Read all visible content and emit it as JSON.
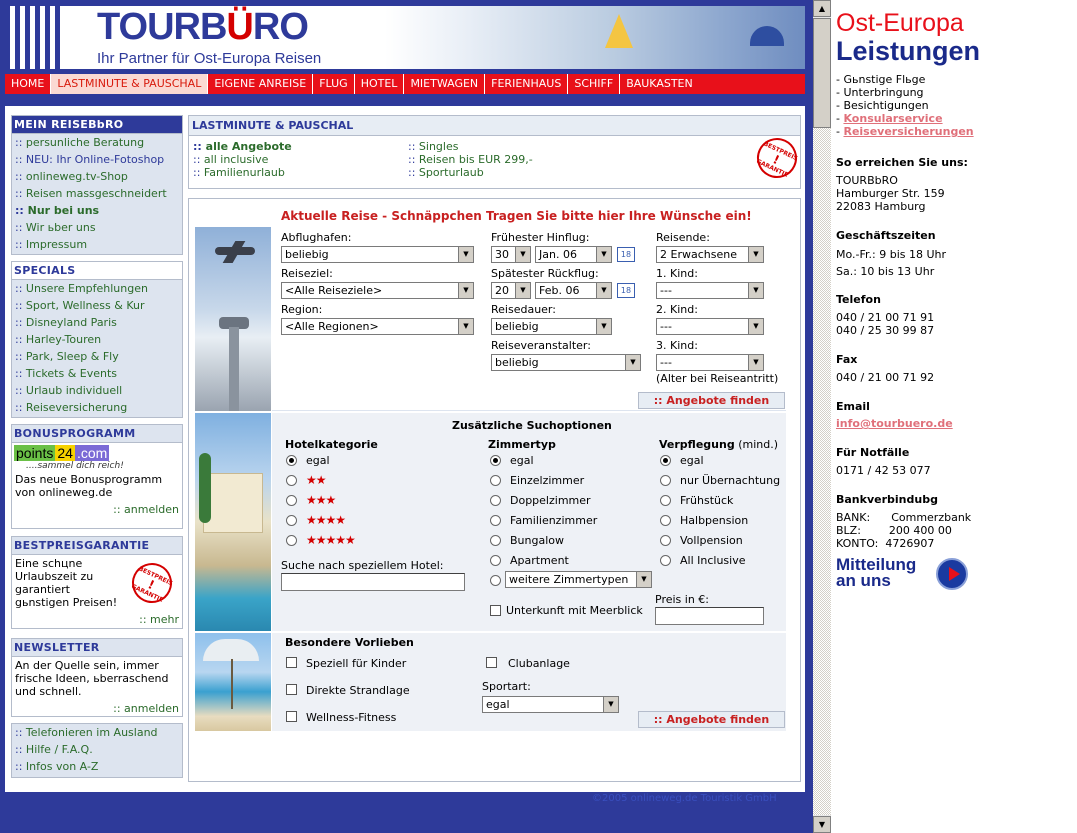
{
  "header": {
    "logo_main": "TOURB",
    "logo_u": "Ü",
    "logo_end": "RO",
    "tagline": "Ihr Partner für Ost-Europa Reisen"
  },
  "nav": [
    "HOME",
    "LASTMINUTE & PAUSCHAL",
    "EIGENE ANREISE",
    "FLUG",
    "HOTEL",
    "MIETWAGEN",
    "FERIENHAUS",
    "SCHIFF",
    "BAUKASTEN"
  ],
  "sidebar": {
    "mein": {
      "title": "MEIN REISEBbRO",
      "items": [
        "persunliche Beratung",
        "NEU: Ihr Online-Fotoshop",
        "onlineweg.tv-Shop",
        "Reisen massgeschneidert",
        "Nur bei uns",
        "Wir ьber uns",
        "Impressum"
      ]
    },
    "specials": {
      "title": "SPECIALS",
      "items": [
        "Unsere Empfehlungen",
        "Sport, Wellness & Kur",
        "Disneyland Paris",
        "Harley-Touren",
        "Park, Sleep & Fly",
        "Tickets & Events",
        "Urlaub individuell",
        "Reiseversicherung"
      ]
    },
    "bonus": {
      "title": "BONUSPROGRAMM",
      "logo_a": "points",
      "logo_b": "24",
      "logo_c": ".com",
      "slogan": "....sammel dich reich!",
      "text": "Das neue Bonusprogramm von onlineweg.de",
      "link": ":: anmelden"
    },
    "bestpreis": {
      "title": "BESTPREISGARANTIE",
      "text": "Eine schцne Urlaubszeit zu garantiert gьnstigen Preisen!",
      "link": ":: mehr",
      "badge_top": "BESTPREIS",
      "badge_bottom": "GARANTIE"
    },
    "newsletter": {
      "title": "NEWSLETTER",
      "text": "An der Quelle sein, immer frische Ideen, ьberraschend und schnell.",
      "link": ":: anmelden"
    },
    "extra": [
      "Telefonieren im Ausland",
      "Hilfe / F.A.Q.",
      "Infos von A-Z"
    ]
  },
  "lastminute": {
    "title": "LASTMINUTE & PAUSCHAL",
    "col1": [
      "alle Angebote",
      "all inclusive",
      "Familienurlaub"
    ],
    "col2": [
      "Singles",
      "Reisen bis EUR 299,-",
      "Sporturlaub"
    ],
    "badge_top": "BESTPREIS",
    "badge_bottom": "GARANTIE"
  },
  "form": {
    "title": "Aktuelle Reise - Schnäppchen Tragen Sie bitte hier Ihre Wünsche ein!",
    "abflughafen_label": "Abflughafen:",
    "abflughafen_value": "beliebig",
    "reiseziel_label": "Reiseziel:",
    "reiseziel_value": "<Alle Reiseziele>",
    "region_label": "Region:",
    "region_value": "<Alle Regionen>",
    "hinflug_label": "Frühester Hinflug:",
    "hinflug_day": "30",
    "hinflug_month": "Jan. 06",
    "rueckflug_label": "Spätester Rückflug:",
    "rueckflug_day": "20",
    "rueckflug_month": "Feb. 06",
    "cal_label": "18",
    "dauer_label": "Reisedauer:",
    "dauer_value": "beliebig",
    "veranstalter_label": "Reiseveranstalter:",
    "veranstalter_value": "beliebig",
    "reisende_label": "Reisende:",
    "reisende_value": "2 Erwachsene",
    "kind1_label": "1. Kind:",
    "kind2_label": "2. Kind:",
    "kind3_label": "3. Kind:",
    "kind_value": "---",
    "alter_note": "(Alter bei Reiseantritt)",
    "submit": ":: Angebote finden",
    "extra_title": "Zusätzliche Suchoptionen",
    "hotel_title": "Hotelkategorie",
    "hotel_options": [
      "egal",
      "★★",
      "★★★",
      "★★★★",
      "★★★★★"
    ],
    "hotel_search_label": "Suche nach speziellem Hotel:",
    "zimmer_title": "Zimmertyp",
    "zimmer_options": [
      "egal",
      "Einzelzimmer",
      "Doppelzimmer",
      "Familienzimmer",
      "Bungalow",
      "Apartment"
    ],
    "zimmer_more": "weitere Zimmertypen",
    "meerblick": "Unterkunft mit Meerblick",
    "verpflegung_title": "Verpflegung",
    "verpflegung_suffix": "(mind.)",
    "verpflegung_options": [
      "egal",
      "nur Übernachtung",
      "Frühstück",
      "Halbpension",
      "Vollpension",
      "All Inclusive"
    ],
    "preis_label": "Preis in €:",
    "vorlieben_title": "Besondere Vorlieben",
    "vorlieben_options": [
      "Speziell für Kinder",
      "Direkte Strandlage",
      "Wellness-Fitness"
    ],
    "clubanlage": "Clubanlage",
    "sportart_label": "Sportart:",
    "sportart_value": "egal"
  },
  "footer": "©2005 onlineweg.de Touristik GmbH",
  "right": {
    "h1": "Ost-Europa",
    "h2": "Leistungen",
    "services": [
      "- Gьnstige Flьge",
      "- Unterbringung",
      "- Besichtigungen"
    ],
    "service_links": [
      "Konsularservice",
      "Reiseversicherungen"
    ],
    "reach_title": "So erreichen Sie uns:",
    "address": [
      "TOURBbRO",
      "Hamburger Str. 159",
      "22083 Hamburg"
    ],
    "hours_title": "Geschäftszeiten",
    "hours": [
      "Mo.-Fr.: 9 bis 18 Uhr",
      "Sa.: 10 bis 13 Uhr"
    ],
    "phone_title": "Telefon",
    "phones": [
      "040 / 21 00 71 91",
      "040 / 25 30 99 87"
    ],
    "fax_title": "Fax",
    "fax": "040 / 21 00 71 92",
    "email_title": "Email",
    "email": "info@tourbuero.de",
    "notfall_title": "Für Notfälle",
    "notfall": "0171 / 42 53 077",
    "bank_title": "Bankverbindubg",
    "bank": [
      "BANK:      Commerzbank",
      "BLZ:        200 400 00",
      "KONTO:  4726907"
    ],
    "mitteilung_1": "Mitteilung",
    "mitteilung_2": "an uns"
  },
  "colors": {
    "brand_blue": "#2e3a9a",
    "nav_red": "#e8101a",
    "link_green": "#2b6b2b",
    "pink_link": "#e0707a"
  }
}
